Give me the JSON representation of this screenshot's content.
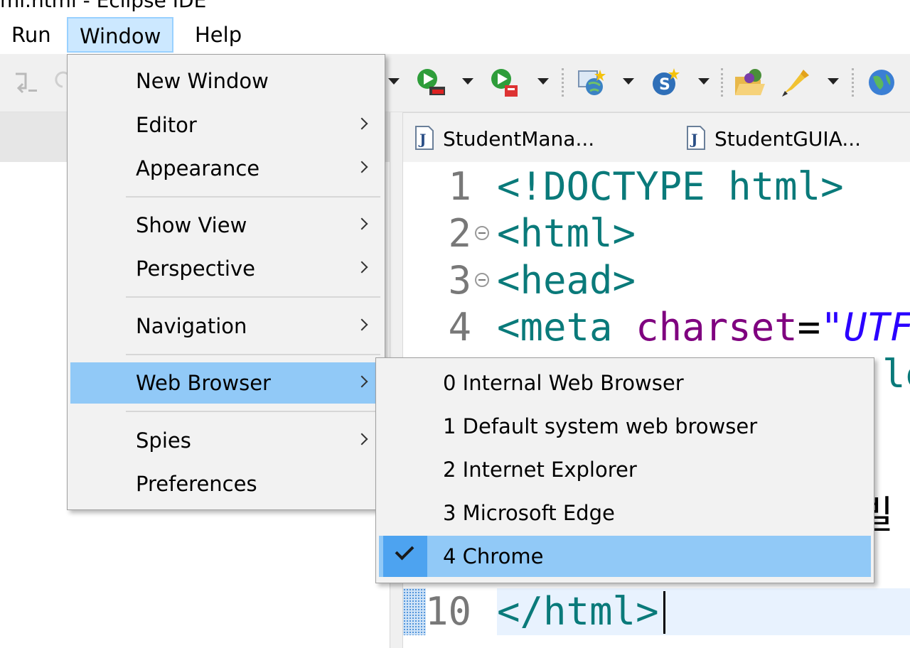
{
  "titlebar": {
    "text": "ml.html - Eclipse IDE"
  },
  "menubar": {
    "run": "Run",
    "window": "Window",
    "help": "Help"
  },
  "tabs": [
    {
      "label": "StudentMana..."
    },
    {
      "label": "StudentGUIA..."
    }
  ],
  "editor": {
    "lines": [
      {
        "num": "1",
        "content": "<!DOCTYPE html>"
      },
      {
        "num": "2",
        "content": "<html>"
      },
      {
        "num": "3",
        "content": "<head>"
      },
      {
        "num": "4",
        "tag": "<meta",
        "attr": "charset",
        "eq": "=",
        "str": "\"UTF"
      },
      {
        "num": "10",
        "content": "</html>"
      }
    ],
    "partial_right_5": "le",
    "partial_right_8": "빌"
  },
  "window_menu": {
    "items": [
      {
        "label": "New Window",
        "submenu": false
      },
      {
        "label": "Editor",
        "submenu": true
      },
      {
        "label": "Appearance",
        "submenu": true
      },
      {
        "label": "Show View",
        "submenu": true
      },
      {
        "label": "Perspective",
        "submenu": true
      },
      {
        "label": "Navigation",
        "submenu": true
      },
      {
        "label": "Web Browser",
        "submenu": true,
        "highlighted": true
      },
      {
        "label": "Spies",
        "submenu": true
      },
      {
        "label": "Preferences",
        "submenu": false
      }
    ]
  },
  "web_browser_submenu": {
    "items": [
      {
        "label": "0 Internal Web Browser",
        "checked": false
      },
      {
        "label": "1 Default system web browser",
        "checked": false
      },
      {
        "label": "2 Internet Explorer",
        "checked": false
      },
      {
        "label": "3 Microsoft Edge",
        "checked": false
      },
      {
        "label": "4 Chrome",
        "checked": true
      }
    ]
  },
  "colors": {
    "menu_bg": "#f2f2f2",
    "highlight": "#91c9f7",
    "tag": "#0a7a7a",
    "attr": "#7f007f",
    "string": "#2a00ff"
  }
}
